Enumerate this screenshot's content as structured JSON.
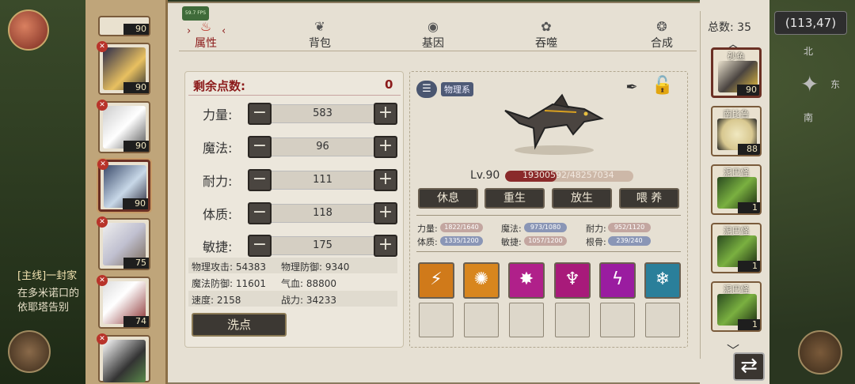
{
  "world": {
    "coords": "(113,47)",
    "quest_title": "[主线]一封家",
    "quest_line1": "在多米诺口的",
    "quest_line2": "依耶塔告别",
    "compass_n": "北",
    "compass_e": "东",
    "compass_s": "南"
  },
  "fps": "59.7 FPS",
  "tabs": [
    {
      "label": "属性",
      "active": true
    },
    {
      "label": "背包"
    },
    {
      "label": "基因"
    },
    {
      "label": "吞噬"
    },
    {
      "label": "合成"
    }
  ],
  "stats_panel": {
    "remaining_label": "剩余点数:",
    "remaining_value": "0",
    "stats": [
      {
        "label": "力量:",
        "value": "583"
      },
      {
        "label": "魔法:",
        "value": "96"
      },
      {
        "label": "耐力:",
        "value": "111"
      },
      {
        "label": "体质:",
        "value": "118"
      },
      {
        "label": "敏捷:",
        "value": "175"
      }
    ],
    "derived": [
      {
        "text": "物理攻击: 54383"
      },
      {
        "text": "物理防御: 9340"
      },
      {
        "text": "魔法防御: 11601"
      },
      {
        "text": "气血: 88800"
      },
      {
        "text": "速度: 2158"
      },
      {
        "text": "战力: 34233"
      }
    ],
    "reset_label": "洗点"
  },
  "pet": {
    "element_tag": "物理系",
    "level": "Lv.90",
    "hp_text": "19300592/48257034",
    "hp_fraction": 0.4,
    "actions": [
      "休息",
      "重生",
      "放生",
      "喂 养"
    ],
    "aptitudes": [
      {
        "label": "力量:",
        "value": "1822/1640"
      },
      {
        "label": "魔法:",
        "value": "973/1080"
      },
      {
        "label": "耐力:",
        "value": "952/1120"
      },
      {
        "label": "体质:",
        "value": "1335/1200"
      },
      {
        "label": "敏捷:",
        "value": "1057/1200"
      },
      {
        "label": "根骨:",
        "value": "239/240"
      }
    ],
    "skills": [
      {
        "icon": "slash-skill-icon",
        "color": "#d07a1a"
      },
      {
        "icon": "sun-skill-icon",
        "color": "#d8861e"
      },
      {
        "icon": "burst-skill-icon",
        "color": "#b0208a"
      },
      {
        "icon": "claw-skill-icon",
        "color": "#a81a7a"
      },
      {
        "icon": "lightning-skill-icon",
        "color": "#9a1ca0"
      },
      {
        "icon": "ice-skill-icon",
        "color": "#2a7f9a"
      }
    ]
  },
  "pet_list": [
    {
      "level": "90"
    },
    {
      "level": "90"
    },
    {
      "level": "90"
    },
    {
      "level": "90"
    },
    {
      "level": "75"
    },
    {
      "level": "74"
    }
  ],
  "collection": {
    "total_label": "总数: 35",
    "items": [
      {
        "name": "砂鱼",
        "level": "90"
      },
      {
        "name": "南比鲁",
        "level": "88"
      },
      {
        "name": "泥巴怪",
        "level": "1"
      },
      {
        "name": "泥巴怪",
        "level": "1"
      },
      {
        "name": "泥巴怪",
        "level": "1"
      }
    ]
  }
}
